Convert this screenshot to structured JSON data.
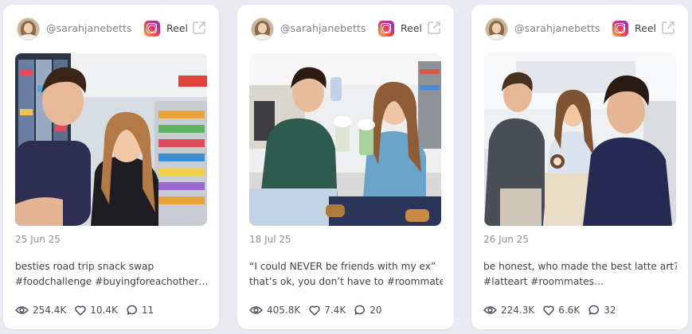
{
  "cards": [
    {
      "username": "@sarahjanebetts",
      "platform": "Reel",
      "date": "25 Jun 25",
      "caption_lines": [
        "besties road trip snack swap",
        "#foodchallenge #buyingforeachother…"
      ],
      "views": "254.4K",
      "likes": "10.4K",
      "comments": "11"
    },
    {
      "username": "@sarahjanebetts",
      "platform": "Reel",
      "date": "18 Jul 25",
      "caption_lines": [
        "“I could NEVER be friends with my ex”",
        "that’s ok, you don’t have to #roommate…"
      ],
      "views": "405.8K",
      "likes": "7.4K",
      "comments": "20"
    },
    {
      "username": "@sarahjanebetts",
      "platform": "Reel",
      "date": "26 Jun 25",
      "caption_lines": [
        "be honest, who made the best latte art?!",
        "#latteart #roommates…"
      ],
      "views": "224.3K",
      "likes": "6.6K",
      "comments": "32"
    }
  ],
  "icons": {
    "platform": "instagram-icon",
    "open": "external-link-icon",
    "views": "eye-icon",
    "likes": "heart-icon",
    "comments": "comment-icon"
  },
  "colors": {
    "background": "#e9ebf0",
    "card": "#ffffff",
    "muted_text": "#8a909b"
  }
}
